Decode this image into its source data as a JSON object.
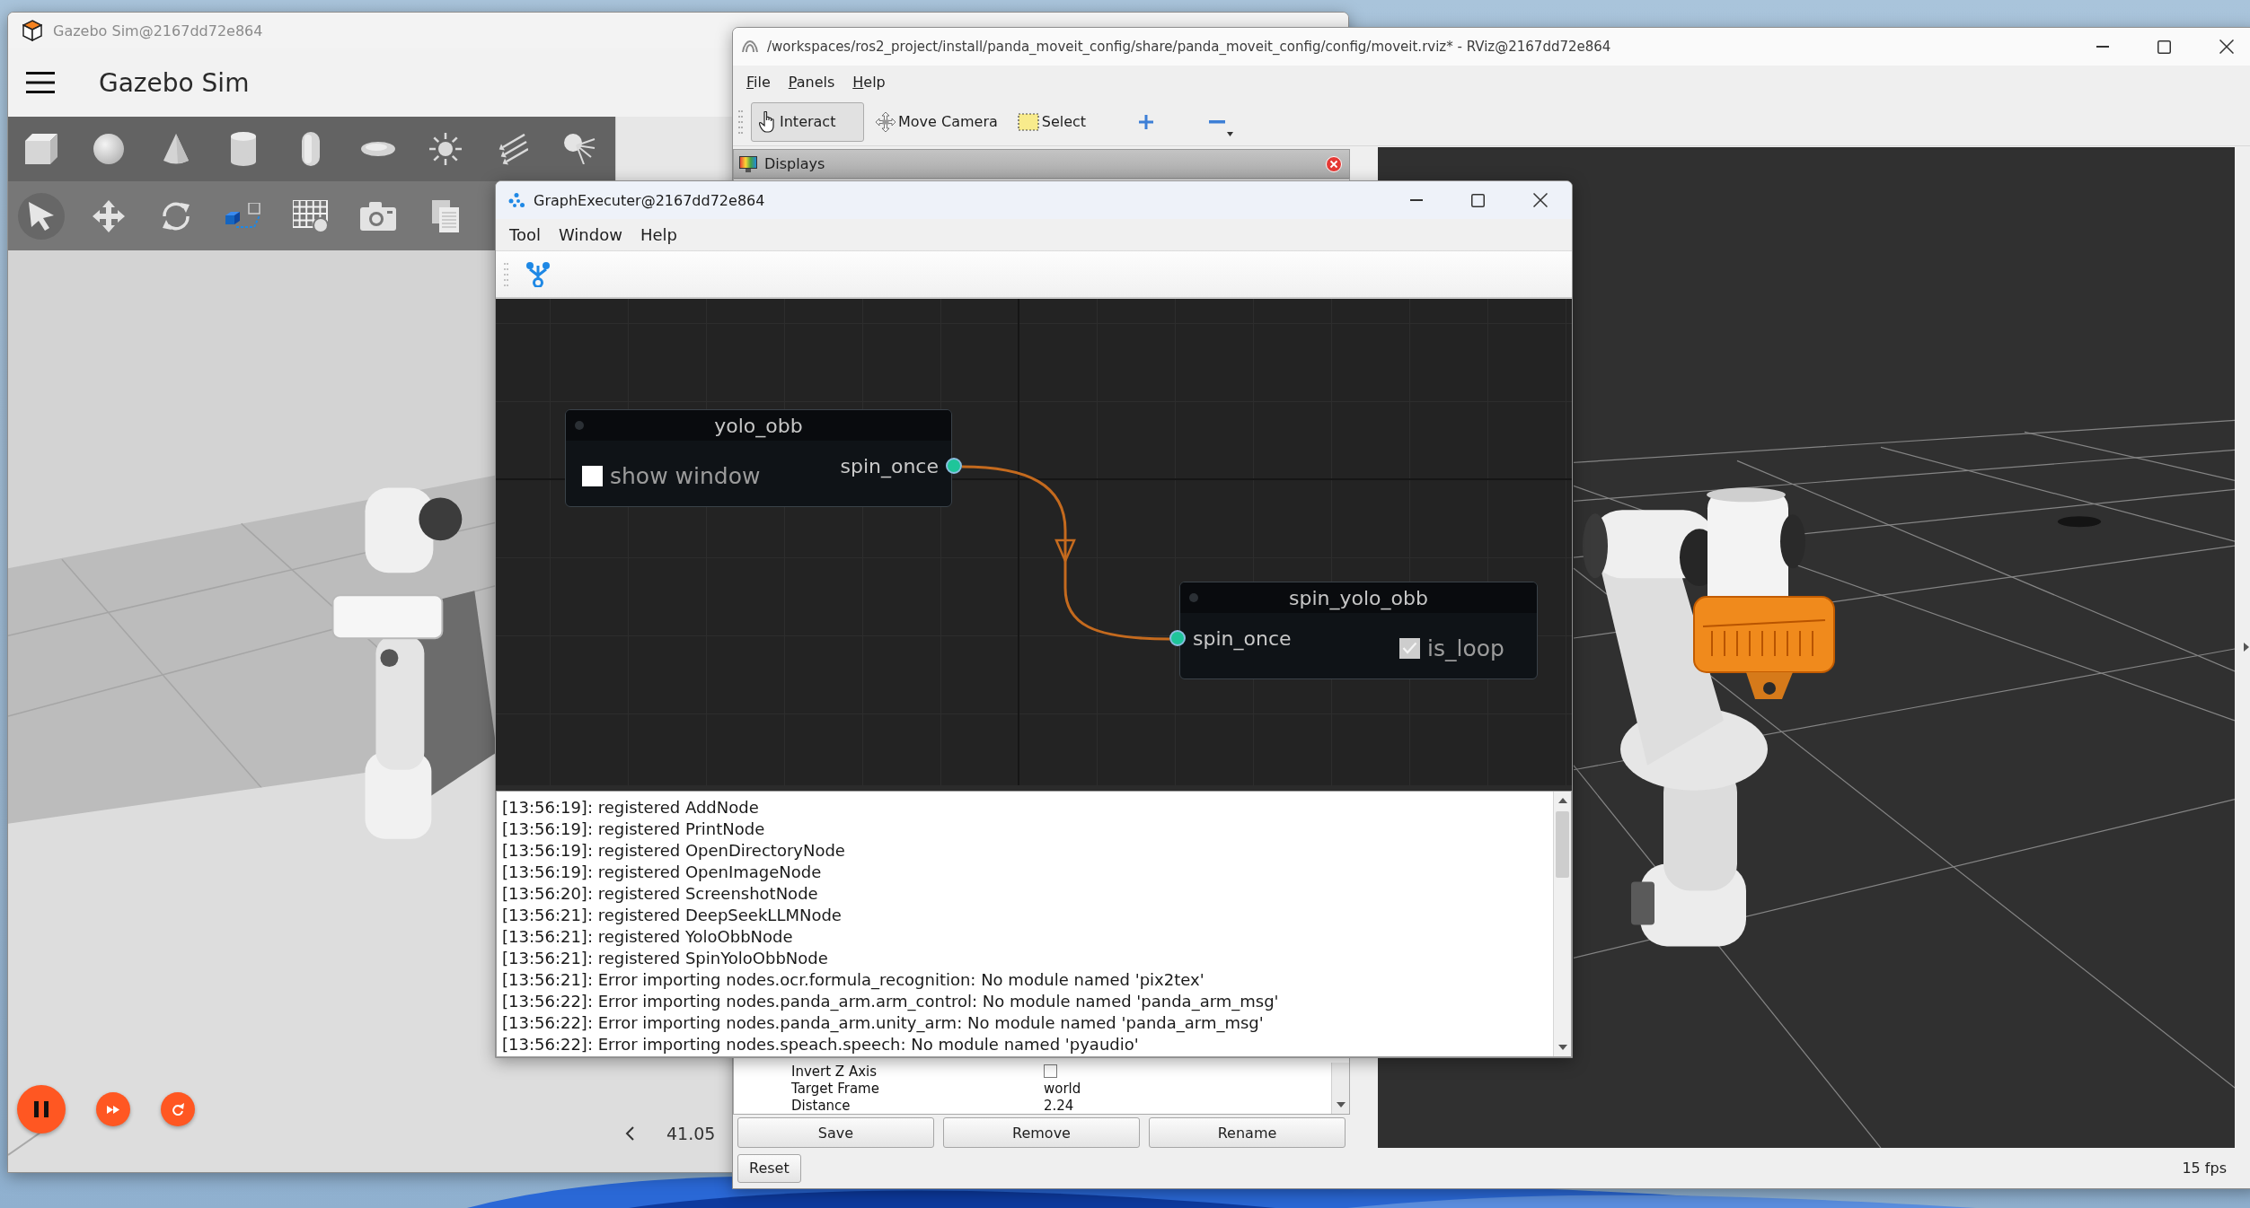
{
  "gazebo": {
    "title": "Gazebo Sim@2167dd72e864",
    "app_name": "Gazebo Sim",
    "view_tools": [
      {
        "selected": true
      },
      {
        "selected": false
      },
      {
        "selected": false
      },
      {
        "selected": false
      },
      {
        "selected": false
      },
      {
        "selected": false
      },
      {
        "selected": false
      }
    ],
    "running": true,
    "time": "41.05"
  },
  "rviz": {
    "title": "/workspaces/ros2_project/install/panda_moveit_config/share/panda_moveit_config/config/moveit.rviz* - RViz@2167dd72e864",
    "menu": [
      "File",
      "Panels",
      "Help"
    ],
    "tools": [
      {
        "label": "Interact",
        "selected": true
      },
      {
        "label": "Move Camera",
        "selected": false
      },
      {
        "label": "Select",
        "selected": false
      }
    ],
    "displays": {
      "title": "Displays",
      "properties": [
        {
          "kind": "checkbox",
          "name": "Invert Z Axis",
          "checked": false
        },
        {
          "kind": "text",
          "name": "Target Frame",
          "value": "world"
        },
        {
          "kind": "text",
          "name": "Distance",
          "value": "2.24"
        }
      ]
    },
    "buttons": [
      "Save",
      "Remove",
      "Rename"
    ],
    "status_bar": {
      "button": "Reset",
      "fps": "15 fps"
    }
  },
  "graph_executer": {
    "title": "GraphExecuter@2167dd72e864",
    "menu": [
      "Tool",
      "Window",
      "Help"
    ],
    "nodes": [
      {
        "title": "yolo_obb",
        "outputs": [
          "spin_once"
        ],
        "options": [
          {
            "label": "show window",
            "checked": false
          }
        ]
      },
      {
        "title": "spin_yolo_obb",
        "inputs": [
          "spin_once"
        ],
        "options": [
          {
            "label": "is_loop",
            "checked": true
          }
        ]
      }
    ],
    "log": [
      "[13:56:19]: registered AddNode",
      "[13:56:19]: registered PrintNode",
      "[13:56:19]: registered OpenDirectoryNode",
      "[13:56:19]: registered OpenImageNode",
      "[13:56:20]: registered ScreenshotNode",
      "[13:56:21]: registered DeepSeekLLMNode",
      "[13:56:21]: registered YoloObbNode",
      "[13:56:21]: registered SpinYoloObbNode",
      "[13:56:21]: Error importing nodes.ocr.formula_recognition: No module named 'pix2tex'",
      "[13:56:22]: Error importing nodes.panda_arm.arm_control: No module named 'panda_arm_msg'",
      "[13:56:22]: Error importing nodes.panda_arm.unity_arm: No module named 'panda_arm_msg'",
      "[13:56:22]: Error importing nodes.speach.speech: No module named 'pyaudio'"
    ]
  }
}
